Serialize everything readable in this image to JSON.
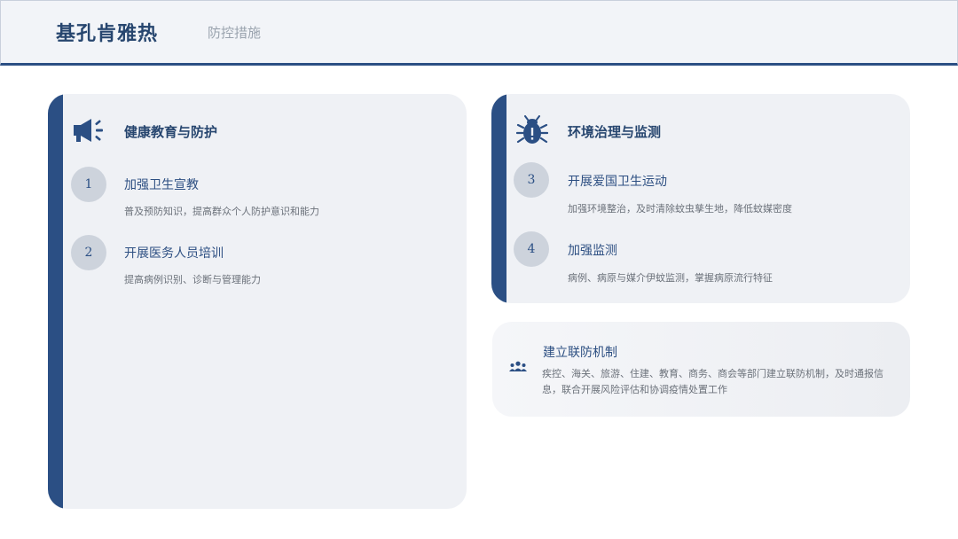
{
  "header": {
    "title": "基孔肯雅热",
    "subtitle": "防控措施"
  },
  "sections": {
    "education": {
      "icon": "megaphone-icon",
      "title": "健康教育与防护",
      "items": [
        {
          "number": "1",
          "title": "加强卫生宣教",
          "desc": "普及预防知识，提高群众个人防护意识和能力"
        },
        {
          "number": "2",
          "title": "开展医务人员培训",
          "desc": "提高病例识别、诊断与管理能力"
        }
      ]
    },
    "environment": {
      "icon": "bug-icon",
      "title": "环境治理与监测",
      "items": [
        {
          "number": "3",
          "title": "开展爱国卫生运动",
          "desc": "加强环境整治，及时清除蚊虫孳生地，降低蚊媒密度"
        },
        {
          "number": "4",
          "title": "加强监测",
          "desc": "病例、病原与媒介伊蚊监测，掌握病原流行特征"
        }
      ]
    },
    "joint": {
      "icon": "people-group-icon",
      "title": "建立联防机制",
      "desc": "疾控、海关、旅游、住建、教育、商务、商会等部门建立联防机制，及时通报信息，联合开展风险评估和协调疫情处置工作"
    }
  },
  "colors": {
    "accent": "#2b4f84",
    "card_bg": "#eff1f5",
    "badge_bg": "#cdd3dc",
    "muted_text": "#6b717a"
  }
}
